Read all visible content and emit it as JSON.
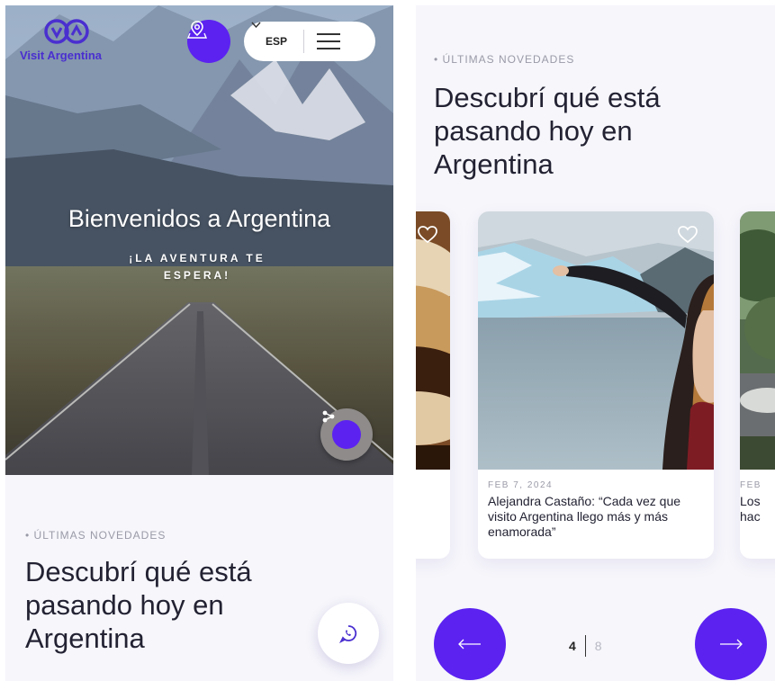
{
  "brand": {
    "name": "Visit Argentina",
    "accent": "#5b22f0",
    "logo_color": "#4a2fd0"
  },
  "header": {
    "language": "ESP",
    "icons": [
      "map-pin-icon",
      "chevron-down-icon",
      "hamburger-menu-icon"
    ]
  },
  "hero": {
    "title": "Bienvenidos a Argentina",
    "subtitle": "¡LA AVENTURA TE ESPERA!"
  },
  "section": {
    "eyebrow": "• ÚLTIMAS NOVEDADES",
    "title": "Descubrí qué está pasando hoy en Argentina"
  },
  "floating": {
    "share_icon": "share-icon",
    "whatsapp_icon": "whatsapp-icon"
  },
  "carousel": {
    "cards": [
      {
        "date": "",
        "title": ""
      },
      {
        "date": "FEB 7, 2024",
        "title": "Alejandra Castaño: “Cada vez que visito Argentina llego más y más enamorada”"
      },
      {
        "date": "FEB",
        "title": "Los\nhac"
      }
    ],
    "current_page": "4",
    "total_pages": "8",
    "prev_icon": "arrow-left-icon",
    "next_icon": "arrow-right-icon"
  }
}
